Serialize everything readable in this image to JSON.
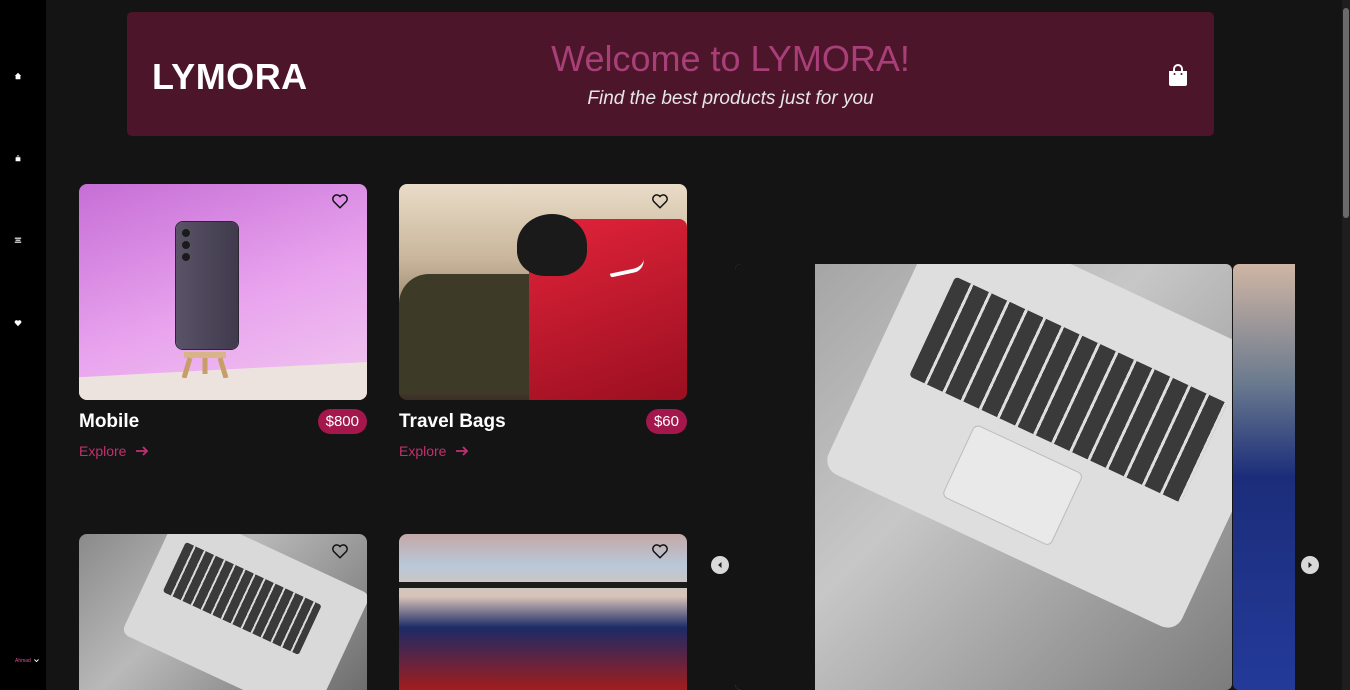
{
  "sidebar": {
    "icons": [
      "home-icon",
      "bag-icon",
      "list-icon",
      "heart-icon"
    ],
    "user_label": "Ahmad"
  },
  "header": {
    "logo": "LYMORA",
    "welcome": "Welcome to LYMORA!",
    "tagline": "Find the best products just for you",
    "cart_icon": "shopping-bag-icon"
  },
  "products": [
    {
      "title": "Mobile",
      "price": "$800",
      "explore": "Explore"
    },
    {
      "title": "Travel Bags",
      "price": "$60",
      "explore": "Explore"
    },
    {
      "title": "",
      "price": "",
      "explore": ""
    },
    {
      "title": "",
      "price": "",
      "explore": ""
    }
  ],
  "colors": {
    "accent": "#a3174c",
    "header_bg": "#4d152a",
    "welcome_text": "#a83f78",
    "explore_text": "#c4306f"
  }
}
